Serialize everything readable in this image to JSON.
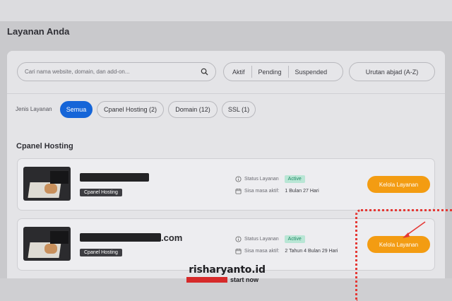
{
  "page": {
    "title": "Layanan Anda"
  },
  "filters": {
    "search_placeholder": "Cari nama website, domain, dan add-on...",
    "status_options": [
      "Aktif",
      "Pending",
      "Suspended"
    ],
    "sort_label": "Urutan abjad (A-Z)",
    "jenis_label": "Jenis Layanan",
    "chips": [
      {
        "label": "Semua",
        "active": true
      },
      {
        "label": "Cpanel Hosting (2)",
        "active": false
      },
      {
        "label": "Domain (12)",
        "active": false
      },
      {
        "label": "SSL (1)",
        "active": false
      }
    ]
  },
  "section": {
    "title": "Cpanel Hosting"
  },
  "services": [
    {
      "name_suffix": "",
      "badge": "Cpanel Hosting",
      "status_label": "Status Layanan",
      "status": "Active",
      "expiry_label": "Sisa masa aktif:",
      "expiry_value": "1 Bulan 27 Hari",
      "button": "Kelola Layanan"
    },
    {
      "name_suffix": ".com",
      "badge": "Cpanel Hosting",
      "status_label": "Status Layanan",
      "status": "Active",
      "expiry_label": "Sisa masa aktif:",
      "expiry_value": "2 Tahun 4 Bulan 29 Hari",
      "button": "Kelola Layanan"
    }
  ],
  "watermark": {
    "main": "risharyanto.id",
    "sub": "start now"
  },
  "colors": {
    "accent_blue": "#1565d8",
    "button_orange": "#f39c12",
    "active_green": "#1e8a64",
    "highlight_red": "#e53935"
  }
}
